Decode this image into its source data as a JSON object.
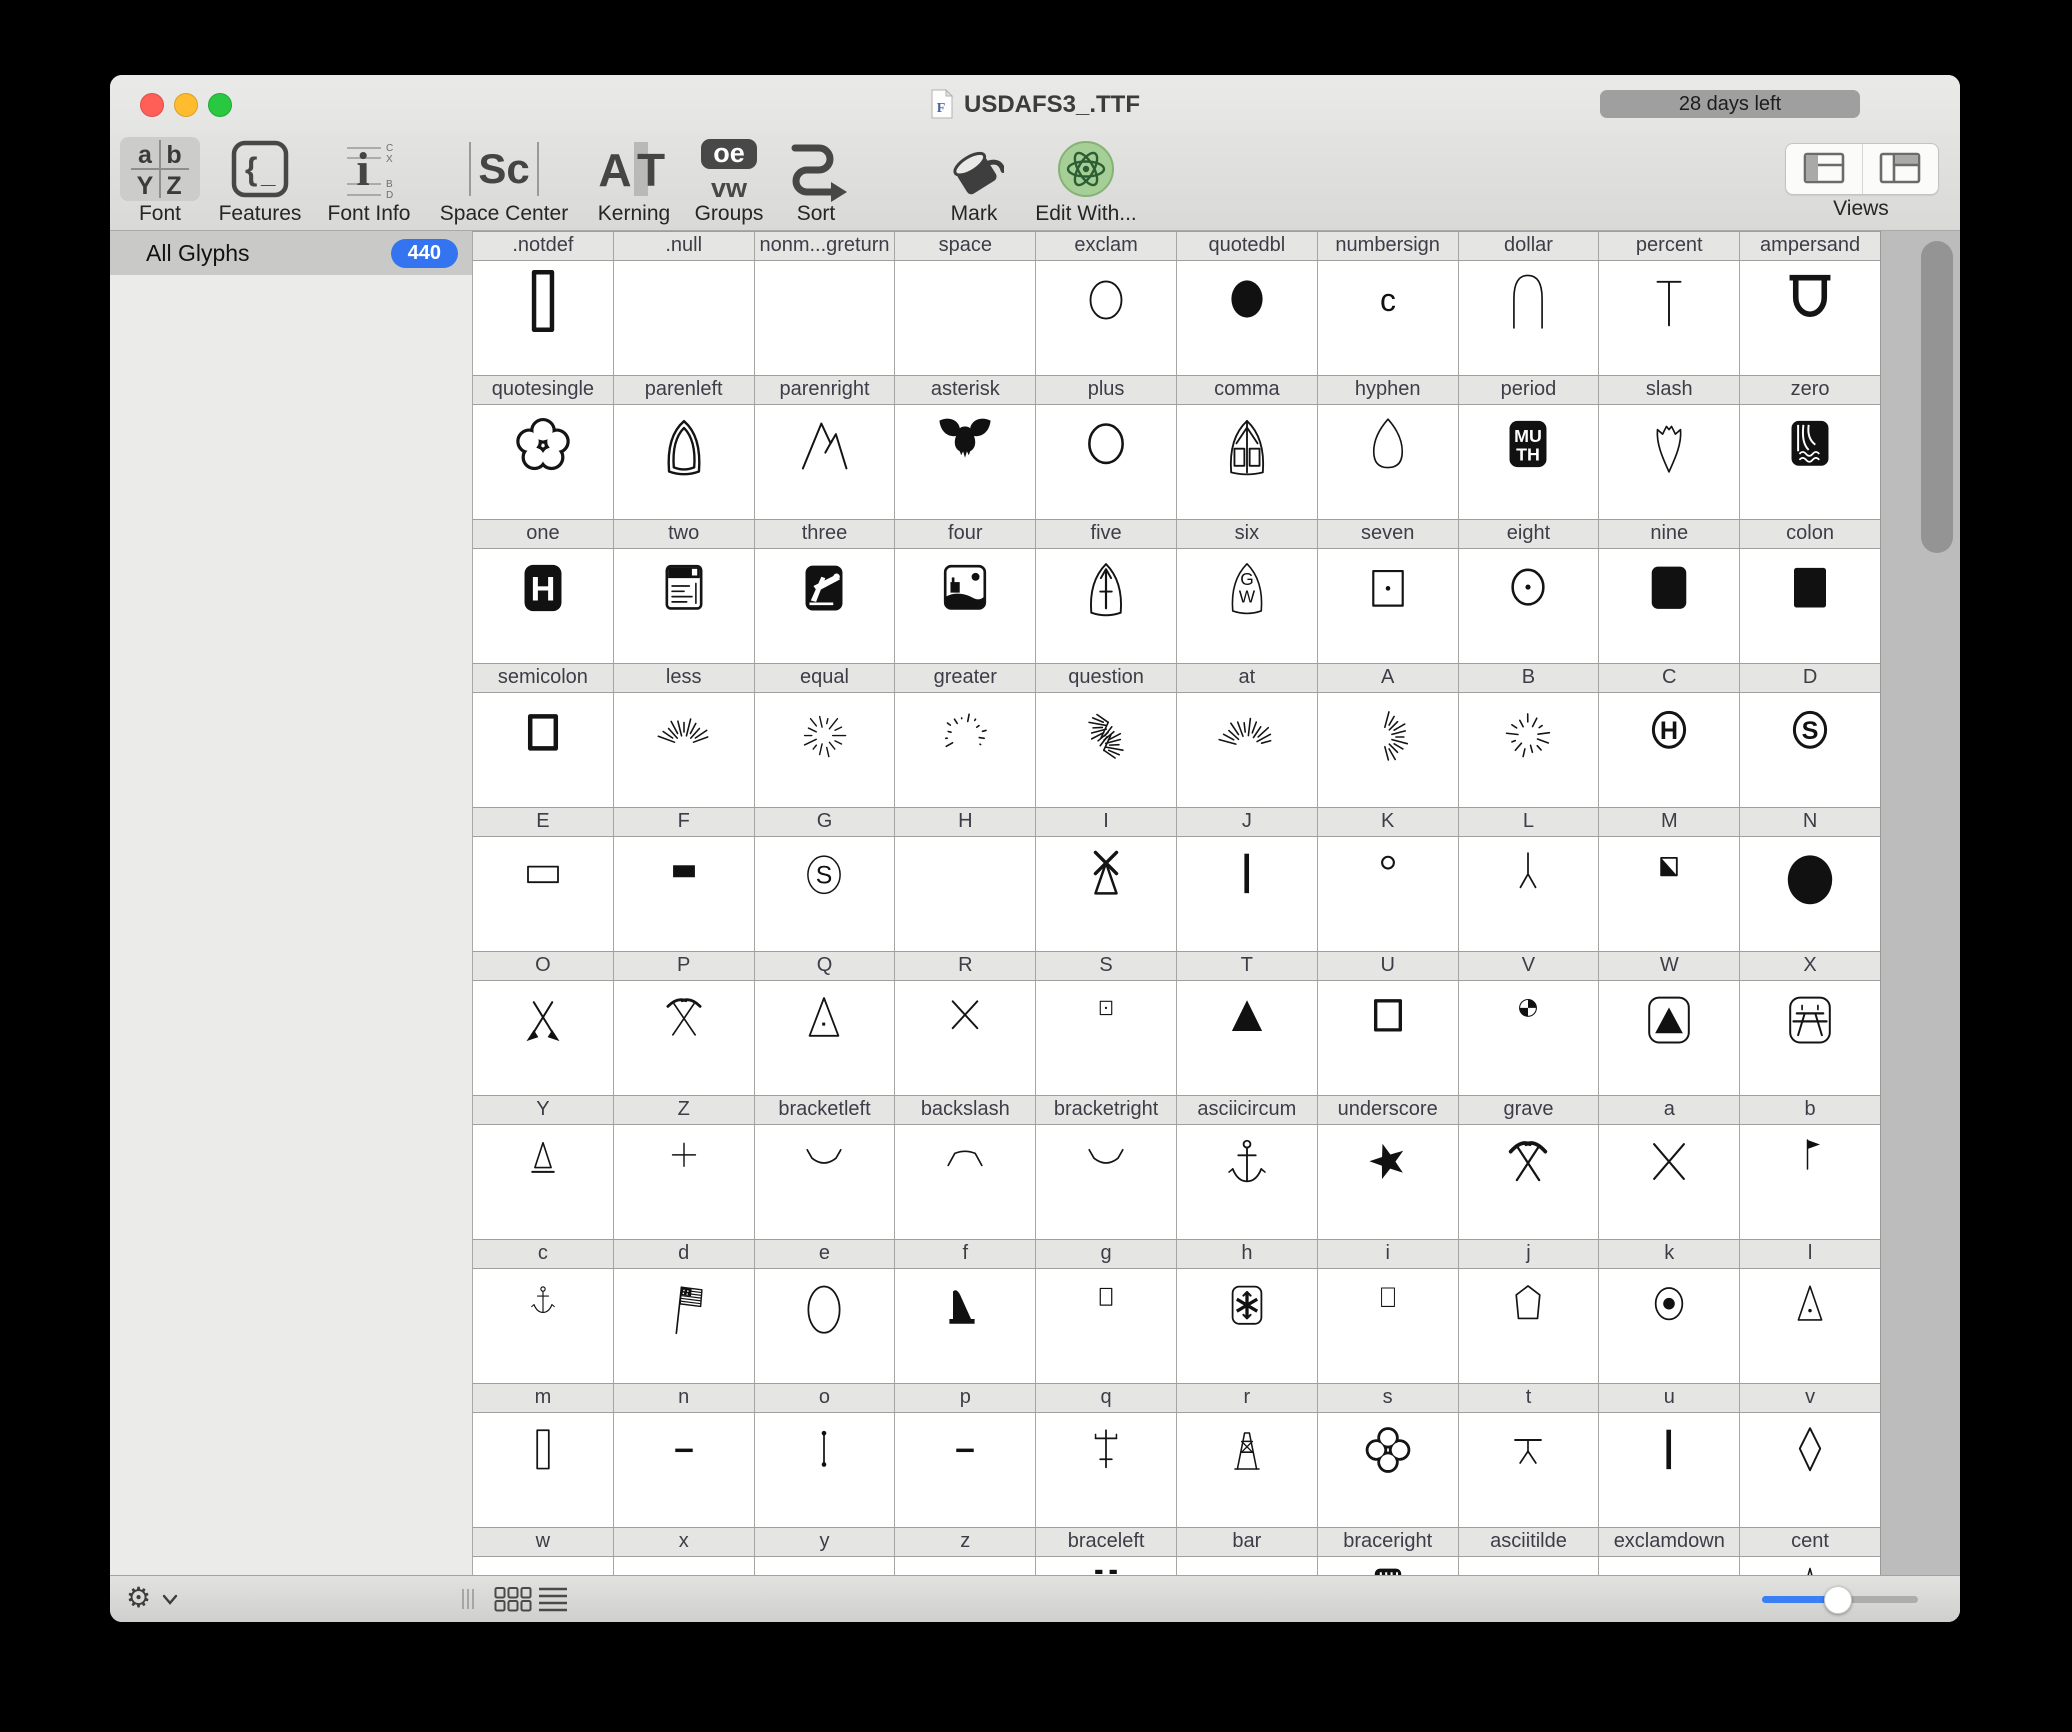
{
  "colors": {
    "accent_blue": "#3574f0",
    "slider_blue": "#3b7ff5",
    "trial_badge_gray": "#9f9f9f",
    "traffic_red": "#ff5f57",
    "traffic_yellow": "#febc2e",
    "traffic_green": "#28c840",
    "sidebar_selection": "#c9c9c7"
  },
  "window": {
    "title": "USDAFS3_.TTF",
    "trial_badge": "28 days left"
  },
  "toolbar": {
    "items": [
      {
        "id": "font",
        "label": "Font",
        "icon": "font-glyph-grid-icon",
        "selected": true
      },
      {
        "id": "features",
        "label": "Features",
        "icon": "braces-icon",
        "selected": false
      },
      {
        "id": "font-info",
        "label": "Font Info",
        "icon": "font-metrics-icon",
        "selected": false
      },
      {
        "id": "space-center",
        "label": "Space Center",
        "icon": "space-center-icon",
        "selected": false
      },
      {
        "id": "kerning",
        "label": "Kerning",
        "icon": "kerning-pair-icon",
        "selected": false
      },
      {
        "id": "groups",
        "label": "Groups",
        "icon": "groups-icon",
        "selected": false
      },
      {
        "id": "sort",
        "label": "Sort",
        "icon": "sort-snake-arrow-icon",
        "selected": false
      },
      {
        "id": "mark",
        "label": "Mark",
        "icon": "paint-bucket-icon",
        "selected": false
      },
      {
        "id": "edit-with",
        "label": "Edit With...",
        "icon": "atom-editor-icon",
        "selected": false
      }
    ],
    "views_label": "Views",
    "view_buttons": [
      {
        "icon": "layout-sidebar-list-icon"
      },
      {
        "icon": "layout-sidebar-top-icon"
      }
    ]
  },
  "sidebar": {
    "items": [
      {
        "label": "All Glyphs",
        "count": "440",
        "selected": true
      }
    ]
  },
  "glyph_grid": {
    "columns": 10,
    "rows": [
      {
        "cells": [
          {
            "name": ".notdef",
            "shape": "notdef-rect"
          },
          {
            "name": ".null",
            "shape": "empty"
          },
          {
            "name": "nonm...greturn",
            "shape": "empty"
          },
          {
            "name": "space",
            "shape": "empty"
          },
          {
            "name": "exclam",
            "shape": "ellipse-outline-thin"
          },
          {
            "name": "quotedbl",
            "shape": "ellipse-filled"
          },
          {
            "name": "numbersign",
            "shape": "letter-c"
          },
          {
            "name": "dollar",
            "shape": "arch-thin"
          },
          {
            "name": "percent",
            "shape": "tee-thin"
          },
          {
            "name": "ampersand",
            "shape": "horseshoe-thick"
          }
        ]
      },
      {
        "cells": [
          {
            "name": "quotesingle",
            "shape": "flower-5"
          },
          {
            "name": "parenleft",
            "shape": "arch-double"
          },
          {
            "name": "parenright",
            "shape": "mountain-peaks"
          },
          {
            "name": "asterisk",
            "shape": "bull-skull"
          },
          {
            "name": "plus",
            "shape": "ellipse-outline"
          },
          {
            "name": "comma",
            "shape": "chapel-arch"
          },
          {
            "name": "hyphen",
            "shape": "dome-thin"
          },
          {
            "name": "period",
            "shape": "box-muth"
          },
          {
            "name": "slash",
            "shape": "arrowhead"
          },
          {
            "name": "zero",
            "shape": "box-waterfall"
          }
        ]
      },
      {
        "cells": [
          {
            "name": "one",
            "shape": "box-h"
          },
          {
            "name": "two",
            "shape": "kiosk-board"
          },
          {
            "name": "three",
            "shape": "box-oilpump"
          },
          {
            "name": "four",
            "shape": "box-ranch"
          },
          {
            "name": "five",
            "shape": "arch-trail-arrow"
          },
          {
            "name": "six",
            "shape": "arch-gw"
          },
          {
            "name": "seven",
            "shape": "square-dot"
          },
          {
            "name": "eight",
            "shape": "circle-dot"
          },
          {
            "name": "nine",
            "shape": "rounded-square-filled"
          },
          {
            "name": "colon",
            "shape": "square-filled"
          }
        ]
      },
      {
        "cells": [
          {
            "name": "semicolon",
            "shape": "square-outline-thick"
          },
          {
            "name": "less",
            "shape": "burst-fan"
          },
          {
            "name": "equal",
            "shape": "burst-star"
          },
          {
            "name": "greater",
            "shape": "burst-arc"
          },
          {
            "name": "question",
            "shape": "burst-spray"
          },
          {
            "name": "at",
            "shape": "burst-v"
          },
          {
            "name": "A",
            "shape": "burst-fan2"
          },
          {
            "name": "B",
            "shape": "burst-swirl"
          },
          {
            "name": "C",
            "shape": "circle-h"
          },
          {
            "name": "D",
            "shape": "circle-s-thick"
          }
        ]
      },
      {
        "cells": [
          {
            "name": "E",
            "shape": "hrect-outline"
          },
          {
            "name": "F",
            "shape": "hrect-filled"
          },
          {
            "name": "G",
            "shape": "circle-s-thin"
          },
          {
            "name": "H",
            "shape": "empty"
          },
          {
            "name": "I",
            "shape": "windmill-x-triangle"
          },
          {
            "name": "J",
            "shape": "vbar-thick"
          },
          {
            "name": "K",
            "shape": "circle-small"
          },
          {
            "name": "L",
            "shape": "fork-down"
          },
          {
            "name": "M",
            "shape": "square-half-diag"
          },
          {
            "name": "N",
            "shape": "circle-filled-large"
          }
        ]
      },
      {
        "cells": [
          {
            "name": "O",
            "shape": "crossed-arrows"
          },
          {
            "name": "P",
            "shape": "crossed-picks-thin"
          },
          {
            "name": "Q",
            "shape": "triangle-dot"
          },
          {
            "name": "R",
            "shape": "x-thin"
          },
          {
            "name": "S",
            "shape": "square-dot-small"
          },
          {
            "name": "T",
            "shape": "triangle-filled"
          },
          {
            "name": "U",
            "shape": "square-outline-big"
          },
          {
            "name": "V",
            "shape": "circle-quadrants"
          },
          {
            "name": "W",
            "shape": "box-tent"
          },
          {
            "name": "X",
            "shape": "box-picnic"
          }
        ]
      },
      {
        "cells": [
          {
            "name": "Y",
            "shape": "triangle-base"
          },
          {
            "name": "Z",
            "shape": "plus-thin"
          },
          {
            "name": "bracketleft",
            "shape": "valley-curve"
          },
          {
            "name": "backslash",
            "shape": "hill-curve"
          },
          {
            "name": "bracketright",
            "shape": "valley-curve"
          },
          {
            "name": "asciicircum",
            "shape": "anchor"
          },
          {
            "name": "underscore",
            "shape": "star-filled"
          },
          {
            "name": "grave",
            "shape": "crossed-picks-thick"
          },
          {
            "name": "a",
            "shape": "x-thin-large"
          },
          {
            "name": "b",
            "shape": "flag-small"
          }
        ]
      },
      {
        "cells": [
          {
            "name": "c",
            "shape": "anchor-small"
          },
          {
            "name": "d",
            "shape": "us-flag"
          },
          {
            "name": "e",
            "shape": "ellipse-large-thin"
          },
          {
            "name": "f",
            "shape": "ramp-silhouette"
          },
          {
            "name": "g",
            "shape": "rect-outline-small"
          },
          {
            "name": "h",
            "shape": "box-snowflake"
          },
          {
            "name": "i",
            "shape": "rect-outline-plain"
          },
          {
            "name": "j",
            "shape": "pentagon-outline"
          },
          {
            "name": "k",
            "shape": "ellipse-big-dot"
          },
          {
            "name": "l",
            "shape": "triangle-small-dot"
          }
        ]
      },
      {
        "cells": [
          {
            "name": "m",
            "shape": "vrect-outline"
          },
          {
            "name": "n",
            "shape": "hline-thick-low"
          },
          {
            "name": "o",
            "shape": "line-dots-vert"
          },
          {
            "name": "p",
            "shape": "hline-thick-low"
          },
          {
            "name": "q",
            "shape": "pole-cross"
          },
          {
            "name": "r",
            "shape": "derrick-frame"
          },
          {
            "name": "s",
            "shape": "flower-4"
          },
          {
            "name": "t",
            "shape": "table-t"
          },
          {
            "name": "u",
            "shape": "vbar-thick"
          },
          {
            "name": "v",
            "shape": "diamond-outline"
          }
        ]
      },
      {
        "cells": [
          {
            "name": "w",
            "shape": "empty"
          },
          {
            "name": "x",
            "shape": "empty"
          },
          {
            "name": "y",
            "shape": "empty"
          },
          {
            "name": "z",
            "shape": "empty"
          },
          {
            "name": "braceleft",
            "shape": "partial-dashes"
          },
          {
            "name": "bar",
            "shape": "empty"
          },
          {
            "name": "braceright",
            "shape": "partial-striped-box"
          },
          {
            "name": "asciitilde",
            "shape": "partial-arc"
          },
          {
            "name": "exclamdown",
            "shape": "empty"
          },
          {
            "name": "cent",
            "shape": "partial-triangle"
          }
        ]
      }
    ]
  },
  "statusbar": {
    "icons": [
      "gear-icon",
      "chevron-down-icon",
      "sidebar-resize-handle",
      "grid-view-icon",
      "list-view-icon"
    ],
    "zoom_slider": {
      "value_percent": 48
    }
  }
}
